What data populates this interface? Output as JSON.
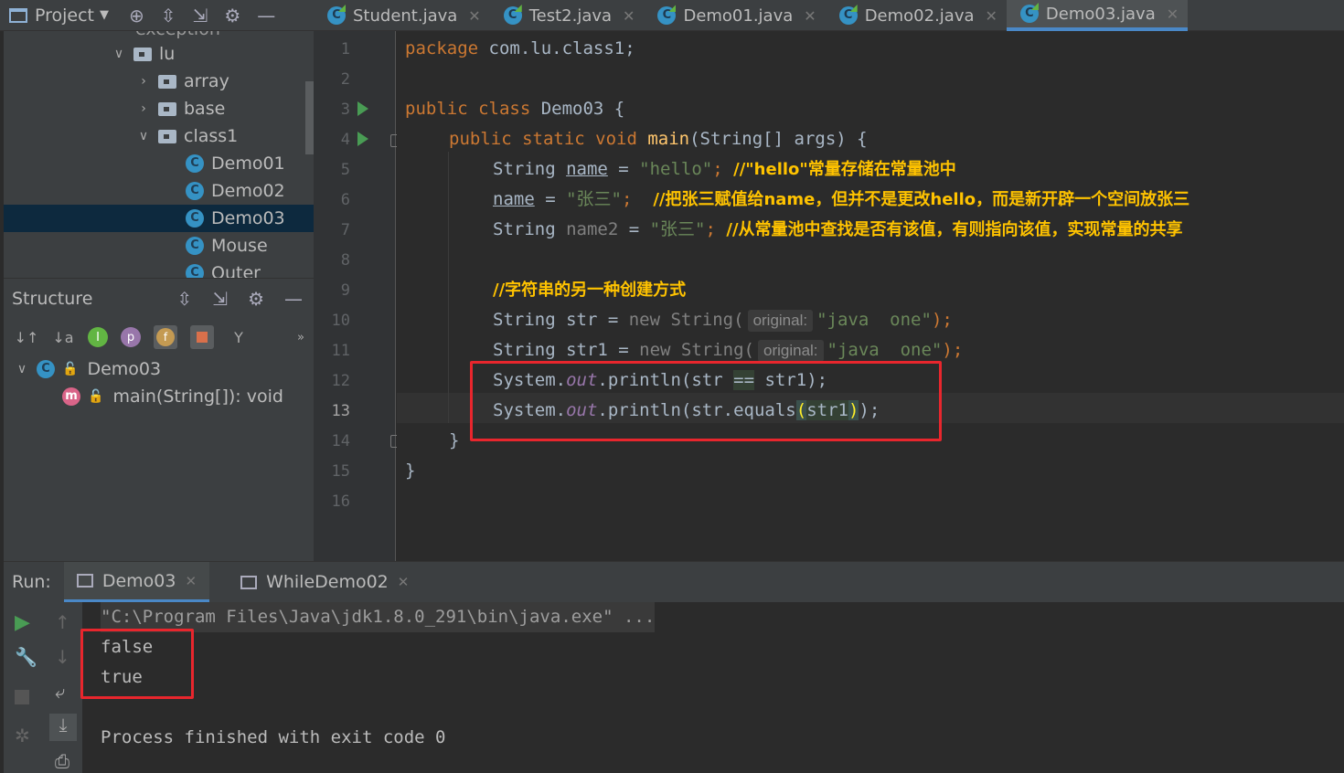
{
  "project": {
    "title": "Project"
  },
  "tabs": [
    {
      "label": "Student.java",
      "active": false
    },
    {
      "label": "Test2.java",
      "active": false
    },
    {
      "label": "Demo01.java",
      "active": false
    },
    {
      "label": "Demo02.java",
      "active": false
    },
    {
      "label": "Demo03.java",
      "active": true
    }
  ],
  "tree": {
    "partial_top": "exception",
    "items": [
      {
        "label": "lu",
        "type": "folder",
        "expanded": true
      },
      {
        "label": "array",
        "type": "folder",
        "expanded": false
      },
      {
        "label": "base",
        "type": "folder",
        "expanded": false
      },
      {
        "label": "class1",
        "type": "folder",
        "expanded": true
      },
      {
        "label": "Demo01",
        "type": "class"
      },
      {
        "label": "Demo02",
        "type": "class"
      },
      {
        "label": "Demo03",
        "type": "class",
        "selected": true
      },
      {
        "label": "Mouse",
        "type": "class"
      },
      {
        "label": "Outer",
        "type": "class"
      }
    ]
  },
  "structure": {
    "title": "Structure",
    "class_name": "Demo03",
    "method": "main(String[]): void"
  },
  "editor": {
    "line_numbers": [
      "1",
      "2",
      "3",
      "4",
      "5",
      "6",
      "7",
      "8",
      "9",
      "10",
      "11",
      "12",
      "13",
      "14",
      "15",
      "16"
    ],
    "current_line": "13",
    "line1": {
      "kw": "package",
      "rest": " com.lu.class1;"
    },
    "line3": {
      "kw": "public class",
      "rest": " Demo03 {"
    },
    "line4": {
      "kw": "public static void",
      "name": " main",
      "rest": "(String[] args) {"
    },
    "line5": {
      "type": "String ",
      "var": "name",
      "eq": " = ",
      "str": "\"hello\"",
      "semi": "; ",
      "comment": "//\"hello\"常量存储在常量池中"
    },
    "line6": {
      "var": "name",
      "eq": " = ",
      "str": "\"张三\"",
      "semi": ";  ",
      "comment": "//把张三赋值给name，但并不是更改hello，而是新开辟一个空间放张三"
    },
    "line7": {
      "type": "String ",
      "var": "name2",
      "eq": " = ",
      "str": "\"张三\"",
      "semi": "; ",
      "comment": "//从常量池中查找是否有该值，有则指向该值，实现常量的共享"
    },
    "line9": {
      "comment": "//字符串的另一种创建方式"
    },
    "line10": {
      "pre": "String str = ",
      "kw": "new",
      "cls": " String(",
      "hint": "original:",
      "str": "\"java  one\"",
      "end": ");"
    },
    "line11": {
      "pre": "String str1 = ",
      "kw": "new",
      "cls": " String(",
      "hint": "original:",
      "str": "\"java  one\"",
      "end": ");"
    },
    "line12": {
      "a": "System.",
      "fld": "out",
      "b": ".println(str ",
      "op": "==",
      "c": " str1);"
    },
    "line13": {
      "a": "System.",
      "fld": "out",
      "b": ".println(str.equals",
      "paren_open": "(",
      "arg": "str1",
      "paren_close": ")",
      "c": ");"
    },
    "line14": {
      "text": "}"
    },
    "line15": {
      "text": "}"
    }
  },
  "run": {
    "label": "Run:",
    "tabs": [
      {
        "label": "Demo03",
        "active": true
      },
      {
        "label": "WhileDemo02",
        "active": false
      }
    ],
    "output": {
      "cmd": "\"C:\\Program Files\\Java\\jdk1.8.0_291\\bin\\java.exe\" ...",
      "lines": [
        "false",
        "true"
      ],
      "finish": "Process finished with exit code 0"
    }
  },
  "colors": {
    "keyword": "#cc7832",
    "string": "#6a8759",
    "comment_annotation": "#ffc300",
    "field": "#9876aa",
    "highlight_box": "#e8262d",
    "accent": "#4a88c7"
  }
}
